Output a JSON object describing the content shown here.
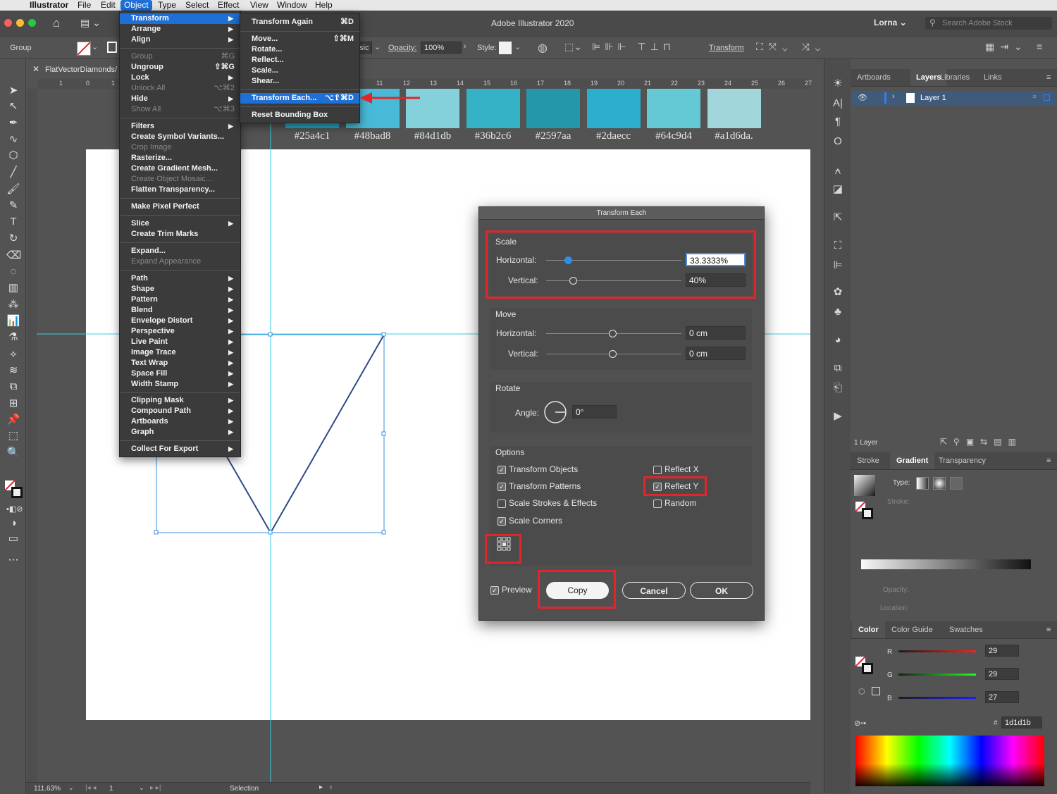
{
  "menubar": {
    "apple": "",
    "items": [
      "Illustrator",
      "File",
      "Edit",
      "Object",
      "Type",
      "Select",
      "Effect",
      "View",
      "Window",
      "Help"
    ],
    "active": "Object"
  },
  "appbar": {
    "title": "Adobe Illustrator 2020",
    "user": "Lorna",
    "search_placeholder": "Search Adobe Stock"
  },
  "control": {
    "group_label": "Group",
    "style_partial": "sic",
    "opacity_label": "Opacity:",
    "opacity_value": "100%",
    "style_label": "Style:",
    "transform_label": "Transform"
  },
  "document": {
    "tab_name": "FlatVectorDiamonds/",
    "zoom": "111.63%",
    "page": "1",
    "tool_status": "Selection"
  },
  "swatches": [
    {
      "hex": "#25a4c1",
      "label": "#25a4c1"
    },
    {
      "hex": "#48bad8",
      "label": "#48bad8"
    },
    {
      "hex": "#84d1db",
      "label": "#84d1db"
    },
    {
      "hex": "#36b2c6",
      "label": "#36b2c6"
    },
    {
      "hex": "#2597aa",
      "label": "#2597aa"
    },
    {
      "hex": "#2daecc",
      "label": "#2daecc"
    },
    {
      "hex": "#64c9d4",
      "label": "#64c9d4"
    },
    {
      "hex": "#a1d6da",
      "label": "#a1d6da."
    }
  ],
  "ruler_numbers": [
    "1",
    "0",
    "1",
    "11",
    "12",
    "13",
    "14",
    "15",
    "16",
    "17",
    "18",
    "19",
    "20",
    "21",
    "22",
    "23",
    "24",
    "25",
    "26",
    "27"
  ],
  "object_menu": {
    "transform": "Transform",
    "arrange": "Arrange",
    "align": "Align",
    "group": "Group",
    "group_sc": "⌘G",
    "ungroup": "Ungroup",
    "ungroup_sc": "⇧⌘G",
    "lock": "Lock",
    "unlock_all": "Unlock All",
    "unlock_all_sc": "⌥⌘2",
    "hide": "Hide",
    "show_all": "Show All",
    "show_all_sc": "⌥⌘3",
    "filters": "Filters",
    "create_symbol_variants": "Create Symbol Variants...",
    "crop_image": "Crop Image",
    "rasterize": "Rasterize...",
    "create_gradient_mesh": "Create Gradient Mesh...",
    "create_object_mosaic": "Create Object Mosaic...",
    "flatten_transparency": "Flatten Transparency...",
    "make_pixel_perfect": "Make Pixel Perfect",
    "slice": "Slice",
    "create_trim_marks": "Create Trim Marks",
    "expand": "Expand...",
    "expand_appearance": "Expand Appearance",
    "path": "Path",
    "shape": "Shape",
    "pattern": "Pattern",
    "blend": "Blend",
    "envelope_distort": "Envelope Distort",
    "perspective": "Perspective",
    "live_paint": "Live Paint",
    "image_trace": "Image Trace",
    "text_wrap": "Text Wrap",
    "space_fill": "Space Fill",
    "width_stamp": "Width Stamp",
    "clipping_mask": "Clipping Mask",
    "compound_path": "Compound Path",
    "artboards": "Artboards",
    "graph": "Graph",
    "collect_for_export": "Collect For Export"
  },
  "transform_submenu": {
    "transform_again": "Transform Again",
    "transform_again_sc": "⌘D",
    "move": "Move...",
    "move_sc": "⇧⌘M",
    "rotate": "Rotate...",
    "reflect": "Reflect...",
    "scale": "Scale...",
    "shear": "Shear...",
    "transform_each": "Transform Each...",
    "transform_each_sc": "⌥⇧⌘D",
    "reset_bounding_box": "Reset Bounding Box"
  },
  "dialog": {
    "title": "Transform Each",
    "scale_label": "Scale",
    "horizontal_label": "Horizontal:",
    "vertical_label": "Vertical:",
    "scale_h": "33.3333%",
    "scale_v": "40%",
    "move_label": "Move",
    "move_h": "0 cm",
    "move_v": "0 cm",
    "rotate_label": "Rotate",
    "angle_label": "Angle:",
    "angle_value": "0°",
    "options_label": "Options",
    "transform_objects": "Transform Objects",
    "transform_patterns": "Transform Patterns",
    "scale_strokes": "Scale Strokes & Effects",
    "scale_corners": "Scale Corners",
    "reflect_x": "Reflect X",
    "reflect_y": "Reflect Y",
    "random": "Random",
    "preview": "Preview",
    "copy": "Copy",
    "cancel": "Cancel",
    "ok": "OK",
    "checks": {
      "transform_objects": true,
      "transform_patterns": true,
      "scale_strokes": false,
      "scale_corners": true,
      "reflect_x": false,
      "reflect_y": true,
      "random": false,
      "preview": true
    }
  },
  "layers_panel": {
    "tabs": [
      "Artboards",
      "Layers",
      "Libraries",
      "Links"
    ],
    "active": "Layers",
    "layer_name": "Layer 1",
    "count": "1 Layer"
  },
  "gradient_panel": {
    "tabs": [
      "Stroke",
      "Gradient",
      "Transparency"
    ],
    "active": "Gradient",
    "type_label": "Type:",
    "stroke_label": "Stroke:",
    "opacity_label": "Opacity:",
    "location_label": "Location:"
  },
  "color_panel": {
    "tabs": [
      "Color",
      "Color Guide",
      "Swatches"
    ],
    "active": "Color",
    "r_label": "R",
    "r": "29",
    "g_label": "G",
    "g": "29",
    "b_label": "B",
    "b": "27",
    "hash": "#",
    "hex": "1d1d1b"
  },
  "colors": {
    "accent": "#1e6fd6",
    "highlight": "#e0262b",
    "guide": "#35d0e6",
    "path": "#2e4a87"
  }
}
